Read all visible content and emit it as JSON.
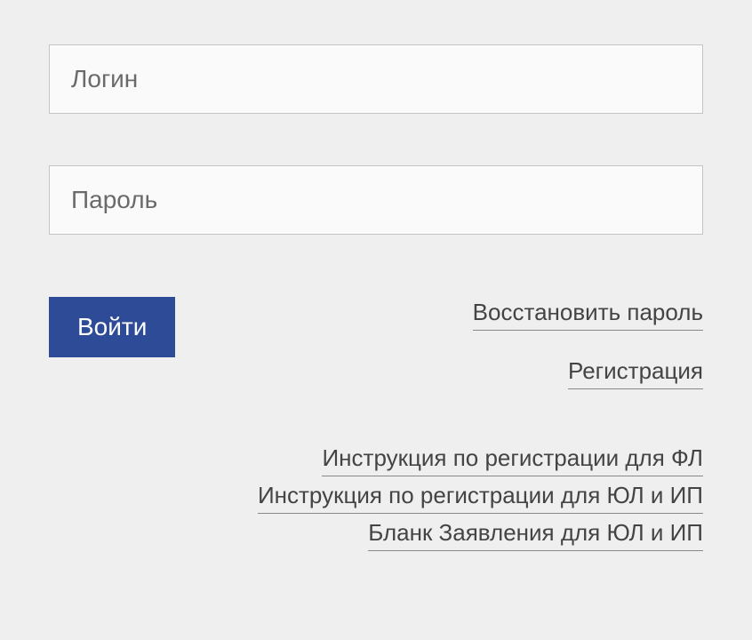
{
  "form": {
    "login_placeholder": "Логин",
    "password_placeholder": "Пароль",
    "submit_label": "Войти"
  },
  "links": {
    "recover_password": "Восстановить пароль",
    "register": "Регистрация",
    "instr_fl": "Инструкция по регистрации для ФЛ",
    "instr_ul_ip": "Инструкция по регистрации для ЮЛ и ИП",
    "blank_ul_ip": "Бланк Заявления для ЮЛ и ИП"
  }
}
